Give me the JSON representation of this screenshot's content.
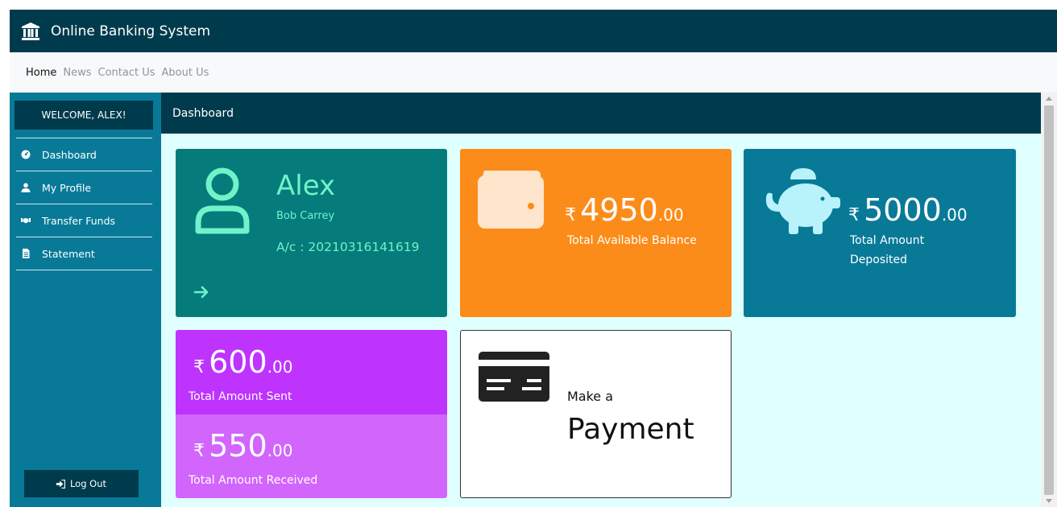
{
  "app": {
    "title": "Online Banking System"
  },
  "nav": [
    {
      "label": "Home",
      "active": true
    },
    {
      "label": "News",
      "active": false
    },
    {
      "label": "Contact Us",
      "active": false
    },
    {
      "label": "About Us",
      "active": false
    }
  ],
  "sidebar": {
    "welcome": "WELCOME, ALEX!",
    "items": [
      {
        "label": "Dashboard",
        "icon": "dashboard-gauge-icon"
      },
      {
        "label": "My Profile",
        "icon": "user-icon"
      },
      {
        "label": "Transfer Funds",
        "icon": "handshake-icon"
      },
      {
        "label": "Statement",
        "icon": "document-icon"
      }
    ],
    "logout": "Log Out"
  },
  "main": {
    "title": "Dashboard"
  },
  "cards": {
    "profile": {
      "name": "Alex",
      "subname": "Bob Carrey",
      "account": "A/c : 20210316141619"
    },
    "balance": {
      "currency": "₹",
      "amount": "4950",
      "decimals": ".00",
      "label": "Total Available Balance"
    },
    "deposited": {
      "currency": "₹",
      "amount": "5000",
      "decimals": ".00",
      "label_line1": "Total Amount",
      "label_line2": "Deposited"
    },
    "sent": {
      "currency": "₹",
      "amount": "600",
      "decimals": ".00",
      "label": "Total Amount Sent"
    },
    "received": {
      "currency": "₹",
      "amount": "550",
      "decimals": ".00",
      "label": "Total Amount Received"
    },
    "payment": {
      "line1": "Make a",
      "line2": "Payment"
    }
  },
  "colors": {
    "header": "#003b4d",
    "sidebar": "#087a98",
    "main_bg": "#e0ffff",
    "profile_card": "#067b7b",
    "profile_text": "#6ff3c8",
    "balance_card": "#fc8c1a",
    "deposit_card": "#087a98",
    "sent_card": "#be33fe",
    "received_card": "#d265fc"
  }
}
